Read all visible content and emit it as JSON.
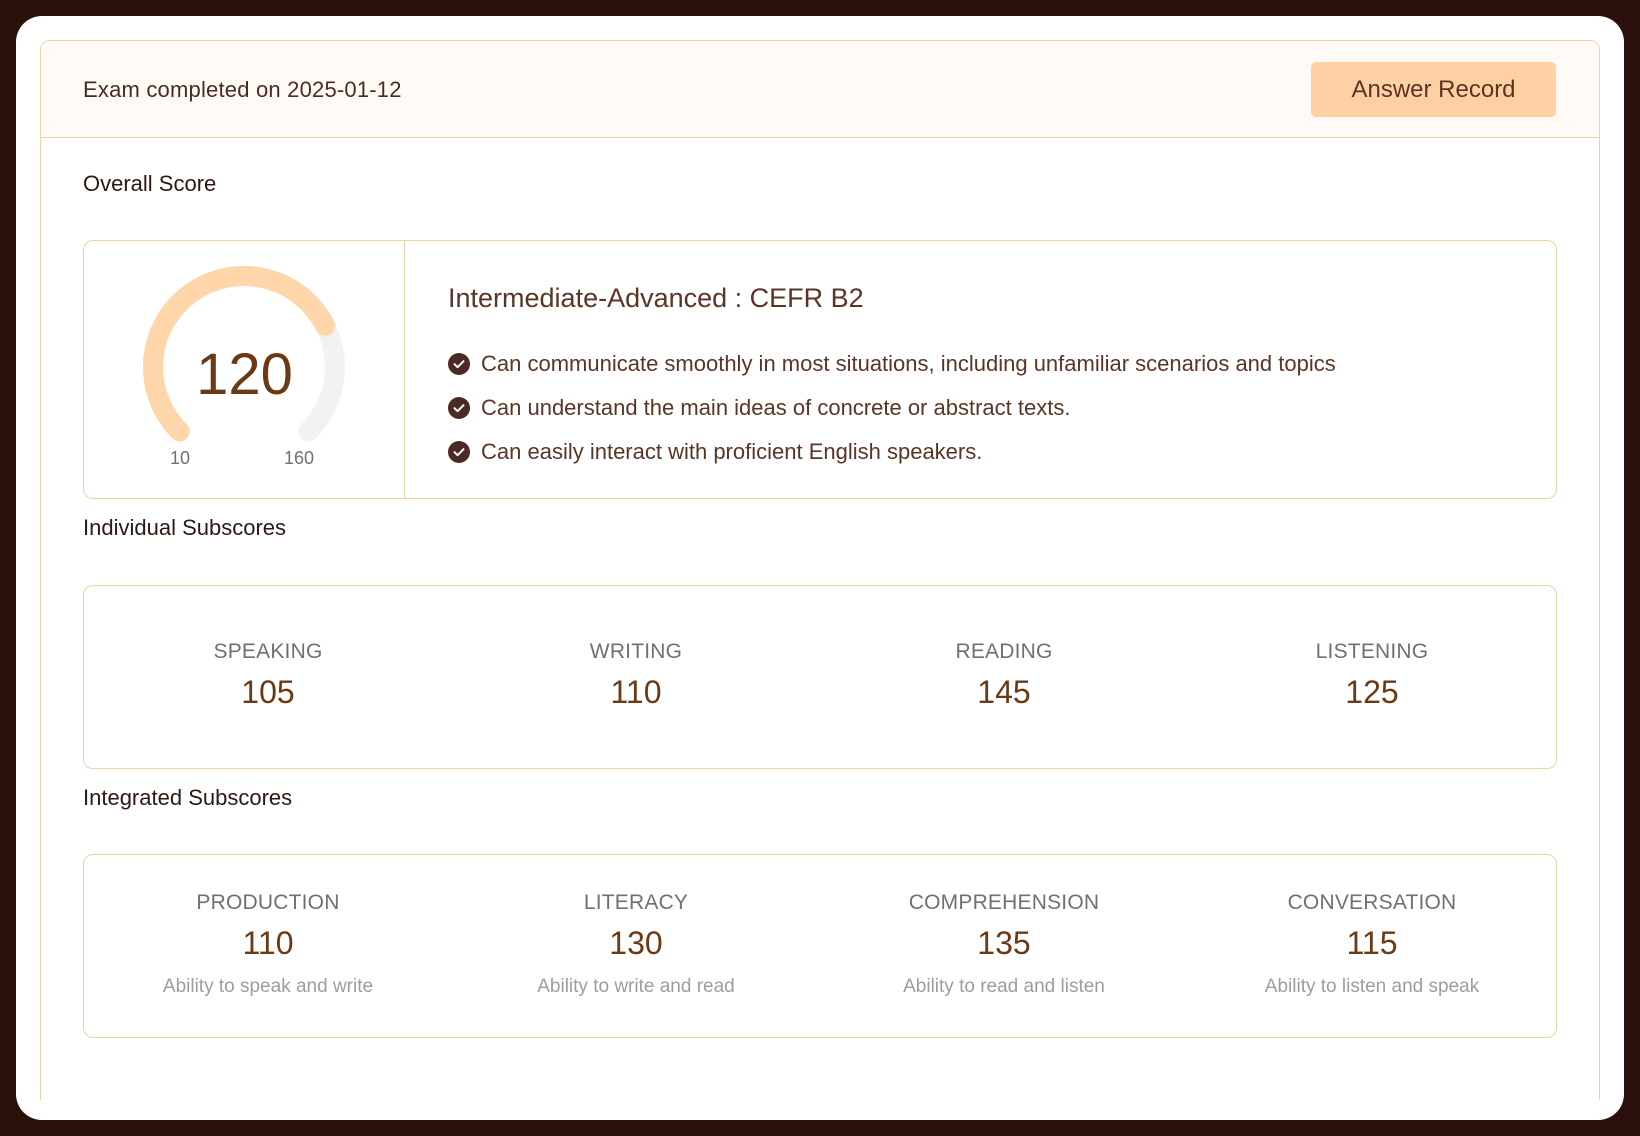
{
  "header": {
    "exam_date_text": "Exam completed on 2025-01-12",
    "answer_record_label": "Answer Record"
  },
  "overall": {
    "section_title": "Overall Score",
    "score": "120",
    "min": "10",
    "max": "160",
    "level_title": "Intermediate-Advanced : CEFR B2",
    "descriptors": [
      "Can communicate smoothly in most situations, including unfamiliar scenarios and topics",
      "Can understand the main ideas of concrete or abstract texts.",
      "Can easily interact with proficient English speakers."
    ],
    "gauge_fill_color": "#ffd6aa",
    "gauge_track_color": "#f2f2f2"
  },
  "individual": {
    "section_title": "Individual Subscores",
    "items": [
      {
        "label": "SPEAKING",
        "value": "105"
      },
      {
        "label": "WRITING",
        "value": "110"
      },
      {
        "label": "READING",
        "value": "145"
      },
      {
        "label": "LISTENING",
        "value": "125"
      }
    ]
  },
  "integrated": {
    "section_title": "Integrated Subscores",
    "items": [
      {
        "label": "PRODUCTION",
        "value": "110",
        "desc": "Ability to speak and write"
      },
      {
        "label": "LITERACY",
        "value": "130",
        "desc": "Ability to write and read"
      },
      {
        "label": "COMPREHENSION",
        "value": "135",
        "desc": "Ability to read and listen"
      },
      {
        "label": "CONVERSATION",
        "value": "115",
        "desc": "Ability to listen and speak"
      }
    ]
  },
  "colors": {
    "accent": "#ffd1a2",
    "border": "#ecd3a6",
    "score_text": "#6b3a14",
    "frame": "#2a100a"
  }
}
